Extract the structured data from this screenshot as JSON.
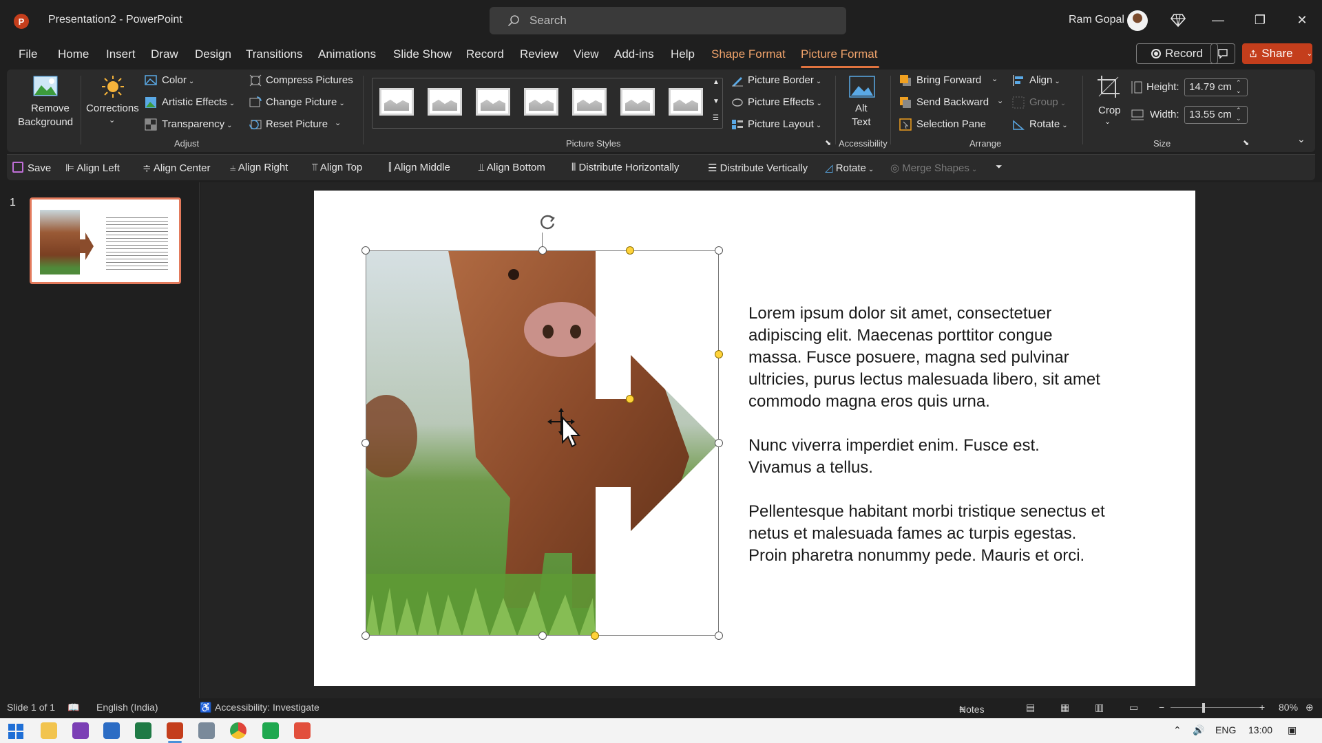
{
  "titlebar": {
    "doc_title": "Presentation2  -  PowerPoint",
    "search_placeholder": "Search",
    "user_name": "Ram Gopal"
  },
  "menu": {
    "tabs": [
      "File",
      "Home",
      "Insert",
      "Draw",
      "Design",
      "Transitions",
      "Animations",
      "Slide Show",
      "Record",
      "Review",
      "View",
      "Add-ins",
      "Help",
      "Shape Format",
      "Picture Format"
    ],
    "active_tab": "Picture Format",
    "record_label": "Record",
    "share_label": "Share"
  },
  "ribbon": {
    "adjust": {
      "remove_bg_1": "Remove",
      "remove_bg_2": "Background",
      "corrections": "Corrections",
      "color": "Color",
      "artistic": "Artistic Effects",
      "transparency": "Transparency",
      "compress": "Compress Pictures",
      "change": "Change Picture",
      "reset": "Reset Picture",
      "group_label": "Adjust"
    },
    "styles": {
      "group_label": "Picture Styles",
      "border": "Picture Border",
      "effects": "Picture Effects",
      "layout": "Picture Layout"
    },
    "accessibility": {
      "alt_1": "Alt",
      "alt_2": "Text",
      "group_label": "Accessibility"
    },
    "arrange": {
      "bring_forward": "Bring Forward",
      "send_backward": "Send Backward",
      "selection_pane": "Selection Pane",
      "align": "Align",
      "group": "Group",
      "rotate": "Rotate",
      "group_label": "Arrange"
    },
    "size": {
      "crop": "Crop",
      "height_label": "Height:",
      "height_value": "14.79 cm",
      "width_label": "Width:",
      "width_value": "13.55 cm",
      "group_label": "Size"
    }
  },
  "qat": {
    "save": "Save",
    "align_left": "Align Left",
    "align_center": "Align Center",
    "align_right": "Align Right",
    "align_top": "Align Top",
    "align_middle": "Align Middle",
    "align_bottom": "Align Bottom",
    "dist_h": "Distribute Horizontally",
    "dist_v": "Distribute Vertically",
    "rotate": "Rotate",
    "merge": "Merge Shapes"
  },
  "slides_panel": {
    "slide_number": "1"
  },
  "slide": {
    "paragraphs": [
      "Lorem ipsum dolor sit amet, consectetuer adipiscing elit. Maecenas porttitor congue massa. Fusce posuere, magna sed pulvinar ultricies, purus lectus malesuada libero, sit amet commodo magna eros quis urna.",
      "Nunc viverra imperdiet enim. Fusce est. Vivamus a tellus.",
      "Pellentesque habitant morbi tristique senectus et netus et malesuada fames ac turpis egestas. Proin pharetra nonummy pede. Mauris et orci."
    ]
  },
  "status": {
    "slide_info": "Slide 1 of 1",
    "language": "English (India)",
    "accessibility": "Accessibility: Investigate",
    "notes": "Notes",
    "zoom": "80%"
  },
  "taskbar": {
    "language": "ENG",
    "time": "13:00"
  },
  "colors": {
    "accent": "#e0733f",
    "share": "#c43e1c",
    "handle_yellow": "#ffd33a"
  }
}
